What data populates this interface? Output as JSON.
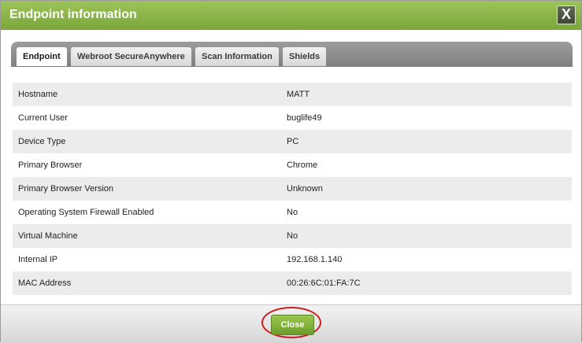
{
  "dialog": {
    "title": "Endpoint information",
    "close_icon_label": "X"
  },
  "tabs": [
    {
      "label": "Endpoint",
      "active": true
    },
    {
      "label": "Webroot SecureAnywhere",
      "active": false
    },
    {
      "label": "Scan Information",
      "active": false
    },
    {
      "label": "Shields",
      "active": false
    }
  ],
  "details": [
    {
      "label": "Hostname",
      "value": "MATT"
    },
    {
      "label": "Current User",
      "value": "buglife49"
    },
    {
      "label": "Device Type",
      "value": "PC"
    },
    {
      "label": "Primary Browser",
      "value": "Chrome"
    },
    {
      "label": "Primary Browser Version",
      "value": "Unknown"
    },
    {
      "label": "Operating System Firewall Enabled",
      "value": "No"
    },
    {
      "label": "Virtual Machine",
      "value": "No"
    },
    {
      "label": "Internal IP",
      "value": "192.168.1.140"
    },
    {
      "label": "MAC Address",
      "value": "00:26:6C:01:FA:7C"
    }
  ],
  "footer": {
    "close_label": "Close"
  },
  "colors": {
    "titlebar": "#8bb64a",
    "close_button": "#7aa63a",
    "highlight": "#cc1b1b"
  }
}
